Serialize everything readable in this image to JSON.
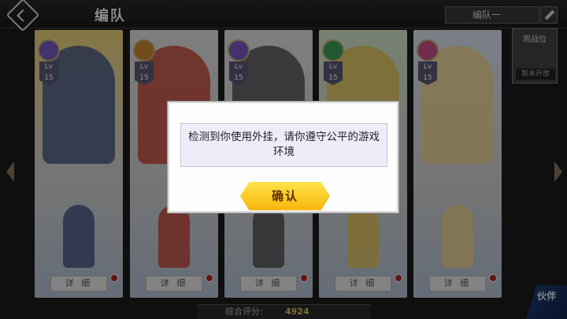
{
  "header": {
    "title": "编队",
    "team_name": "编队一"
  },
  "guard_slot": {
    "label": "观战位",
    "sub": "暂未开放"
  },
  "cards": [
    {
      "level": "Lv 15",
      "role_color": "#7a5cc7",
      "detail_label": "详 细",
      "portrait_color": "#4a5a8a",
      "bg": "#f2d77a"
    },
    {
      "level": "Lv 15",
      "role_color": "#d08b2c",
      "detail_label": "详 细",
      "portrait_color": "#c84a3a",
      "bg": "#e6e6e6"
    },
    {
      "level": "Lv 15",
      "role_color": "#7a5cc7",
      "detail_label": "详 细",
      "portrait_color": "#555555",
      "bg": "#e6e6e6"
    },
    {
      "level": "Lv 15",
      "role_color": "#3aa05a",
      "detail_label": "详 细",
      "portrait_color": "#e8c85a",
      "bg": "#d9ecd0"
    },
    {
      "level": "Lv 15",
      "role_color": "#d0508a",
      "detail_label": "详 细",
      "portrait_color": "#f3d890",
      "bg": "#dfe8f5"
    }
  ],
  "score": {
    "label": "综合评分:",
    "value": "4924"
  },
  "partner_button": "伙伴",
  "dialog": {
    "message": "检测到你使用外挂，请你遵守公平的游戏环境",
    "confirm_label": "确认"
  }
}
